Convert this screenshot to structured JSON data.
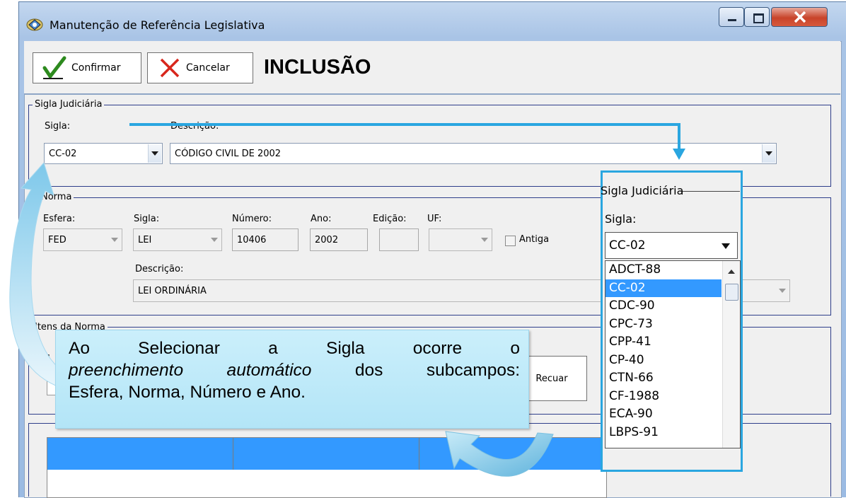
{
  "window": {
    "title": "Manutenção de Referência Legislativa"
  },
  "toolbar": {
    "confirm_label": "Confirmar",
    "cancel_label": "Cancelar",
    "mode_label": "INCLUSÃO"
  },
  "sigla_judiciaria": {
    "group_label": "Sigla Judiciária",
    "sigla_label": "Sigla:",
    "sigla_value": "CC-02",
    "descricao_label": "Descrição:",
    "descricao_value": "CÓDIGO CIVIL DE 2002"
  },
  "norma": {
    "group_label": "Norma",
    "esfera_label": "Esfera:",
    "esfera_value": "FED",
    "sigla_label": "Sigla:",
    "sigla_value": "LEI",
    "numero_label": "Número:",
    "numero_value": "10406",
    "ano_label": "Ano:",
    "ano_value": "2002",
    "edicao_label": "Edição:",
    "edicao_value": "",
    "uf_label": "UF:",
    "uf_value": "",
    "antiga_label": "Antiga",
    "descricao_label": "Descrição:",
    "descricao_value": "LEI ORDINÁRIA"
  },
  "itens_norma": {
    "group_label": "Itens da Norma",
    "recuar_label": "Recuar",
    "cut_label": "I"
  },
  "zoom_popup": {
    "group_label": "Sigla Judiciária",
    "sigla_label": "Sigla:",
    "sigla_value": "CC-02",
    "options": [
      "ADCT-88",
      "CC-02",
      "CDC-90",
      "CPC-73",
      "CPP-41",
      "CP-40",
      "CTN-66",
      "CF-1988",
      "ECA-90",
      "LBPS-91"
    ],
    "selected_index": 1
  },
  "callout": {
    "text_1": "Ao Selecionar a Sigla ocorre o",
    "text_2_italic": "preenchimento automático",
    "text_2_rest": " dos subcampos:",
    "text_3": "Esfera, Norma, Número e Ano."
  },
  "colors": {
    "accent_arrow": "#2aa6e0",
    "selection": "#3399ff",
    "callout_bg": "#c4ecfa",
    "group_border": "#2e3e8a"
  },
  "icons": [
    "window-app-icon",
    "checkmark-icon",
    "x-icon",
    "minimize-icon",
    "maximize-icon",
    "close-icon",
    "dropdown-arrow-icon",
    "curved-arrow-icon",
    "connector-arrow-icon"
  ]
}
